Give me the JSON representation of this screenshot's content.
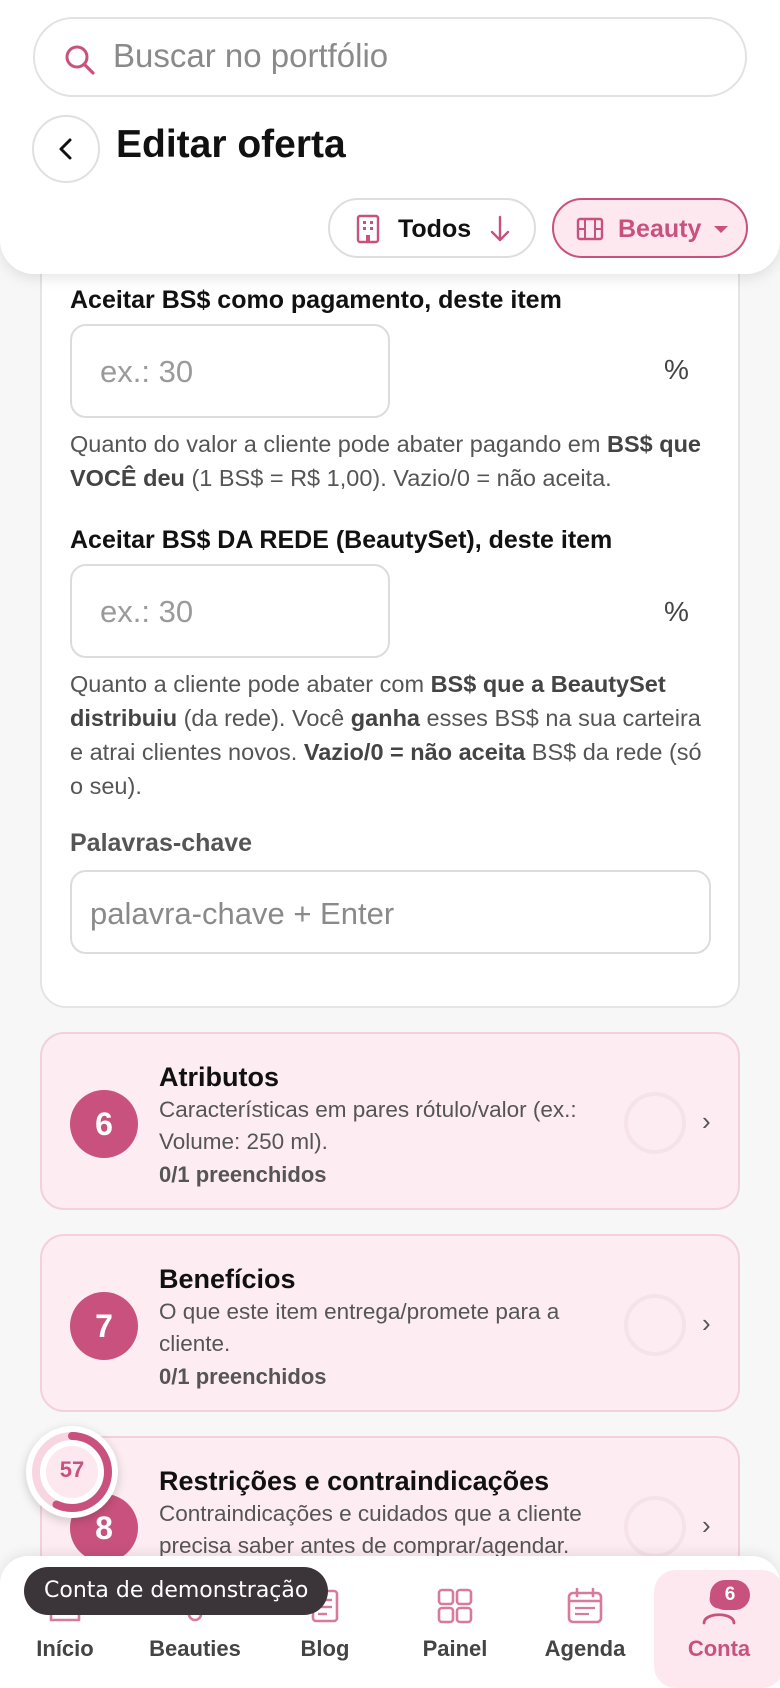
{
  "search": {
    "placeholder": "Buscar no portfólio"
  },
  "header": {
    "title": "Editar oferta",
    "filters": {
      "todos_label": "Todos",
      "beauty_label": "Beauty"
    }
  },
  "form": {
    "accept_bs": {
      "label": "Aceitar BS$ como pagamento, deste item",
      "placeholder": "ex.: 30",
      "unit": "%",
      "help_1": "Quanto do valor a cliente pode abater pagando em ",
      "help_bold": "BS$ que VOCÊ deu",
      "help_2": " (1 BS$ = R$ 1,00). Vazio/0 = não aceita."
    },
    "accept_network": {
      "label": "Aceitar BS$ DA REDE (BeautySet), deste item",
      "placeholder": "ex.: 30",
      "unit": "%",
      "help_1": "Quanto a cliente pode abater com ",
      "help_bold_1": "BS$ que a BeautySet distribuiu",
      "help_2": " (da rede). Você ",
      "help_bold_2": "ganha",
      "help_3": " esses BS$ na sua carteira e atrai clientes novos. ",
      "help_bold_3": "Vazio/0 = não aceita",
      "help_4": " BS$ da rede (só o seu)."
    },
    "keywords": {
      "label": "Palavras-chave",
      "placeholder": "palavra-chave + Enter"
    }
  },
  "steps": [
    {
      "number": "6",
      "title": "Atributos",
      "description": "Características em pares rótulo/valor (ex.: Volume: 250 ml).",
      "count": "0/1 preenchidos"
    },
    {
      "number": "7",
      "title": "Benefícios",
      "description": "O que este item entrega/promete para a cliente.",
      "count": "0/1 preenchidos"
    },
    {
      "number": "8",
      "title": "Restrições e contraindicações",
      "description": "Contraindicações e cuidados que a cliente precisa saber antes de comprar/agendar.",
      "count": ""
    }
  ],
  "progress": {
    "value": "57",
    "fraction": 0.57
  },
  "demo_label": "Conta de demonstração",
  "bottom_nav": [
    {
      "label": "Início",
      "icon": "home-icon"
    },
    {
      "label": "Beauties",
      "icon": "beauties-icon"
    },
    {
      "label": "Blog",
      "icon": "blog-icon"
    },
    {
      "label": "Painel",
      "icon": "grid-icon"
    },
    {
      "label": "Agenda",
      "icon": "calendar-icon"
    },
    {
      "label": "Conta",
      "icon": "user-icon",
      "badge": "6",
      "active": true
    }
  ],
  "colors": {
    "accent": "#c8527d",
    "accent_light": "#fde8ef",
    "step_bg": "#fdedf2"
  }
}
